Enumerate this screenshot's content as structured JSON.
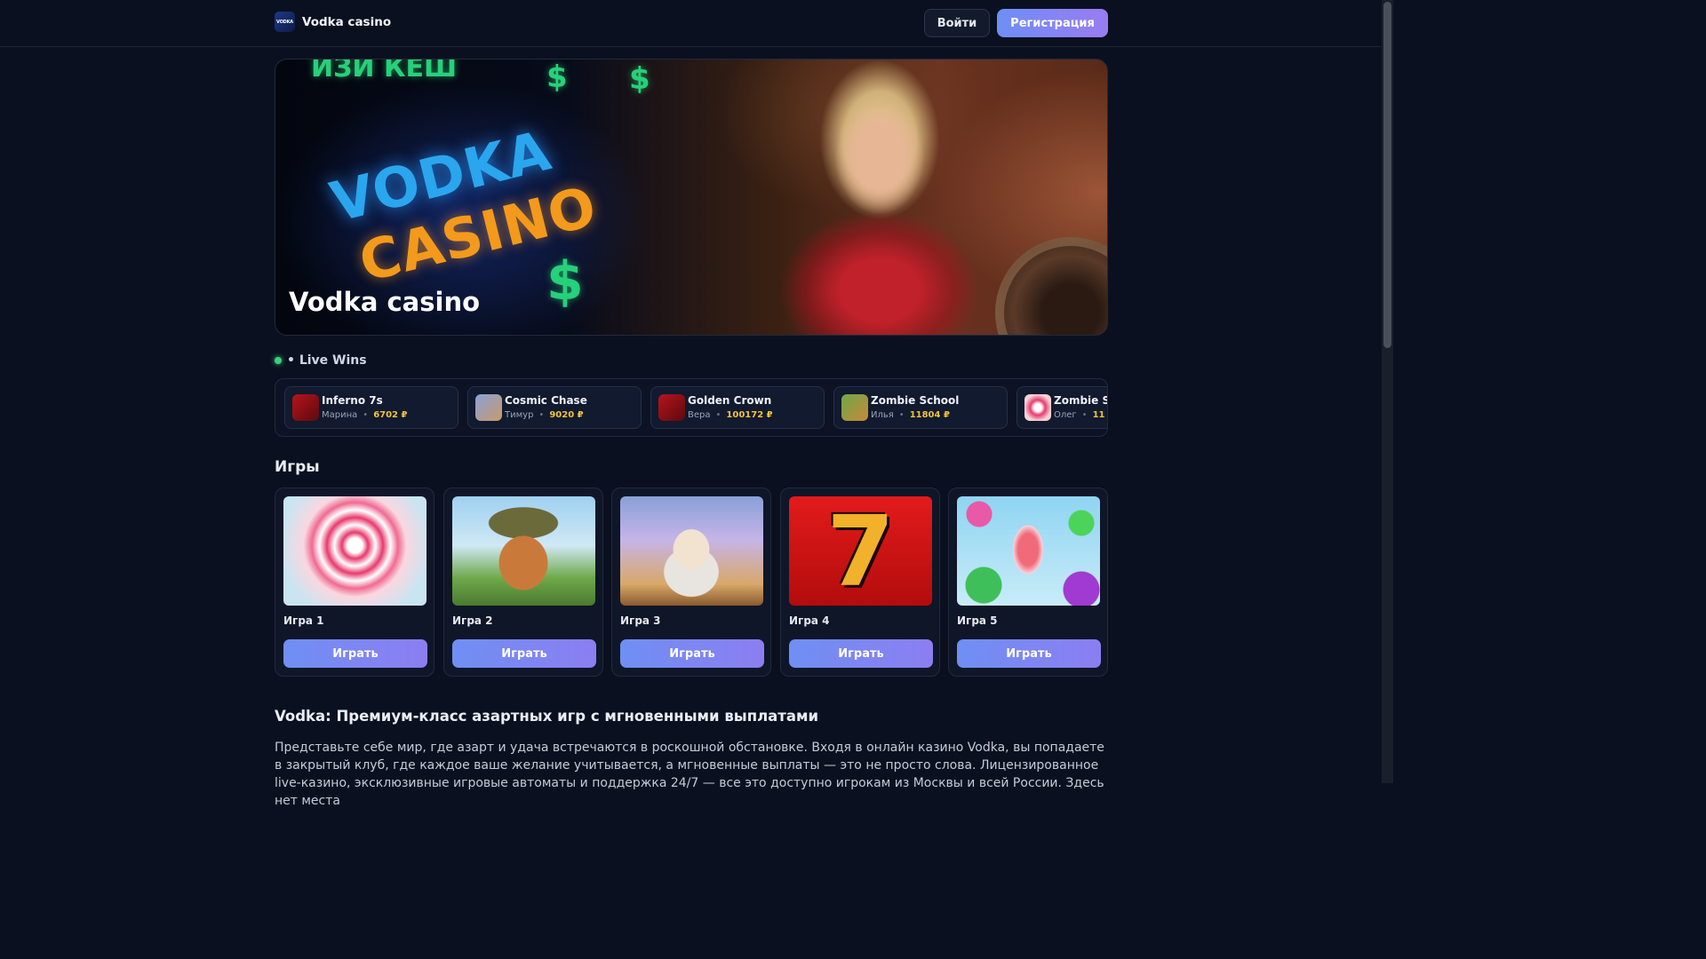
{
  "header": {
    "logo_text": "VODKA",
    "brand": "Vodka casino",
    "login_label": "Войти",
    "register_label": "Регистрация"
  },
  "hero": {
    "logo_line1": "VODKA",
    "logo_line2": "CASINO",
    "title": "Vodka casino"
  },
  "live_wins": {
    "title": "• Live Wins",
    "items": [
      {
        "game": "Inferno 7s",
        "player": "Марина",
        "amount": "6702 ₽",
        "icon": "hell-hot-icon"
      },
      {
        "game": "Cosmic Chase",
        "player": "Тимур",
        "amount": "9020 ₽",
        "icon": "gates-of-olympus-icon"
      },
      {
        "game": "Golden Crown",
        "player": "Вера",
        "amount": "100172 ₽",
        "icon": "hell-hot-icon"
      },
      {
        "game": "Zombie School",
        "player": "Илья",
        "amount": "11804 ₽",
        "icon": "dog-hunt-icon"
      },
      {
        "game": "Zombie S",
        "player": "Олег",
        "amount": "11",
        "icon": "candy-icon"
      }
    ]
  },
  "games": {
    "title": "Игры",
    "items": [
      {
        "name": "Игра 1",
        "play_label": "Играть",
        "icon": "lollipop-icon"
      },
      {
        "name": "Игра 2",
        "play_label": "Играть",
        "icon": "dog-icon"
      },
      {
        "name": "Игра 3",
        "play_label": "Играть",
        "icon": "zeus-icon"
      },
      {
        "name": "Игра 4",
        "play_label": "Играть",
        "icon": "lucky-seven-icon"
      },
      {
        "name": "Игра 5",
        "play_label": "Играть",
        "icon": "gumball-machine-icon"
      }
    ]
  },
  "article": {
    "title": "Vodka: Премиум-класс азартных игр с мгновенными выплатами",
    "text": "Представьте себе мир, где азарт и удача встречаются в роскошной обстановке. Входя в онлайн казино Vodka, вы попадаете в закрытый клуб, где каждое ваше желание учитывается, а мгновенные выплаты — это не просто слова. Лицензированное live-казино, эксклюзивные игровые автоматы и поддержка 24/7 — все это доступно игрокам из Москвы и всей России. Здесь нет места"
  },
  "colors": {
    "background": "#0b1020",
    "accent_from": "#6e8ff5",
    "accent_to": "#9a7bf2",
    "win_amount": "#f3c23a",
    "live_dot": "#3ad07a"
  }
}
